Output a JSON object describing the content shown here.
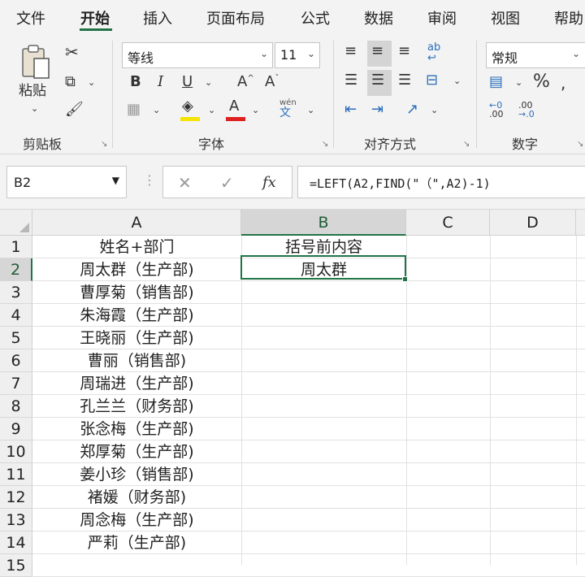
{
  "ribbon_tabs": [
    "文件",
    "开始",
    "插入",
    "页面布局",
    "公式",
    "数据",
    "审阅",
    "视图",
    "帮助"
  ],
  "active_tab": "开始",
  "clipboard": {
    "paste_label": "粘贴",
    "group_label": "剪贴板"
  },
  "font": {
    "name": "等线",
    "size": "11",
    "group_label": "字体",
    "bold": "B",
    "italic": "I",
    "underline": "U",
    "grow": "A",
    "shrink": "A",
    "font_color_letter": "A",
    "phonetic_top": "wén",
    "phonetic_bottom": "文"
  },
  "alignment": {
    "group_label": "对齐方式",
    "wrap_text": "ab"
  },
  "number": {
    "format": "常规",
    "group_label": "数字",
    "percent": "%",
    "inc_decimal_top": "←0",
    "inc_decimal_bottom": ".00",
    "dec_decimal_top": ".00",
    "dec_decimal_bottom": "→.0"
  },
  "formula_bar": {
    "name_box": "B2",
    "fx": "fx",
    "formula": "=LEFT(A2,FIND(\"（\",A2)-1)"
  },
  "grid": {
    "columns": [
      "A",
      "B",
      "C",
      "D"
    ],
    "selected_column": "B",
    "selected_row": "2",
    "rows": [
      {
        "num": "1",
        "a": "姓名+部门",
        "b": "括号前内容"
      },
      {
        "num": "2",
        "a": "周太群（生产部)",
        "b": "周太群"
      },
      {
        "num": "3",
        "a": "曹厚菊（销售部)",
        "b": ""
      },
      {
        "num": "4",
        "a": "朱海霞（生产部)",
        "b": ""
      },
      {
        "num": "5",
        "a": "王晓丽（生产部)",
        "b": ""
      },
      {
        "num": "6",
        "a": "曹丽（销售部)",
        "b": ""
      },
      {
        "num": "7",
        "a": "周瑞进（生产部)",
        "b": ""
      },
      {
        "num": "8",
        "a": "孔兰兰（财务部)",
        "b": ""
      },
      {
        "num": "9",
        "a": "张念梅（生产部)",
        "b": ""
      },
      {
        "num": "10",
        "a": "郑厚菊（生产部)",
        "b": ""
      },
      {
        "num": "11",
        "a": "姜小珍（销售部)",
        "b": ""
      },
      {
        "num": "12",
        "a": "褚媛（财务部)",
        "b": ""
      },
      {
        "num": "13",
        "a": "周念梅（生产部)",
        "b": ""
      },
      {
        "num": "14",
        "a": "严莉（生产部)",
        "b": ""
      },
      {
        "num": "15",
        "a": "",
        "b": ""
      }
    ]
  },
  "colors": {
    "accent": "#217346",
    "font_color_bar": "#e02020",
    "highlight_bar": "#f5e400"
  }
}
